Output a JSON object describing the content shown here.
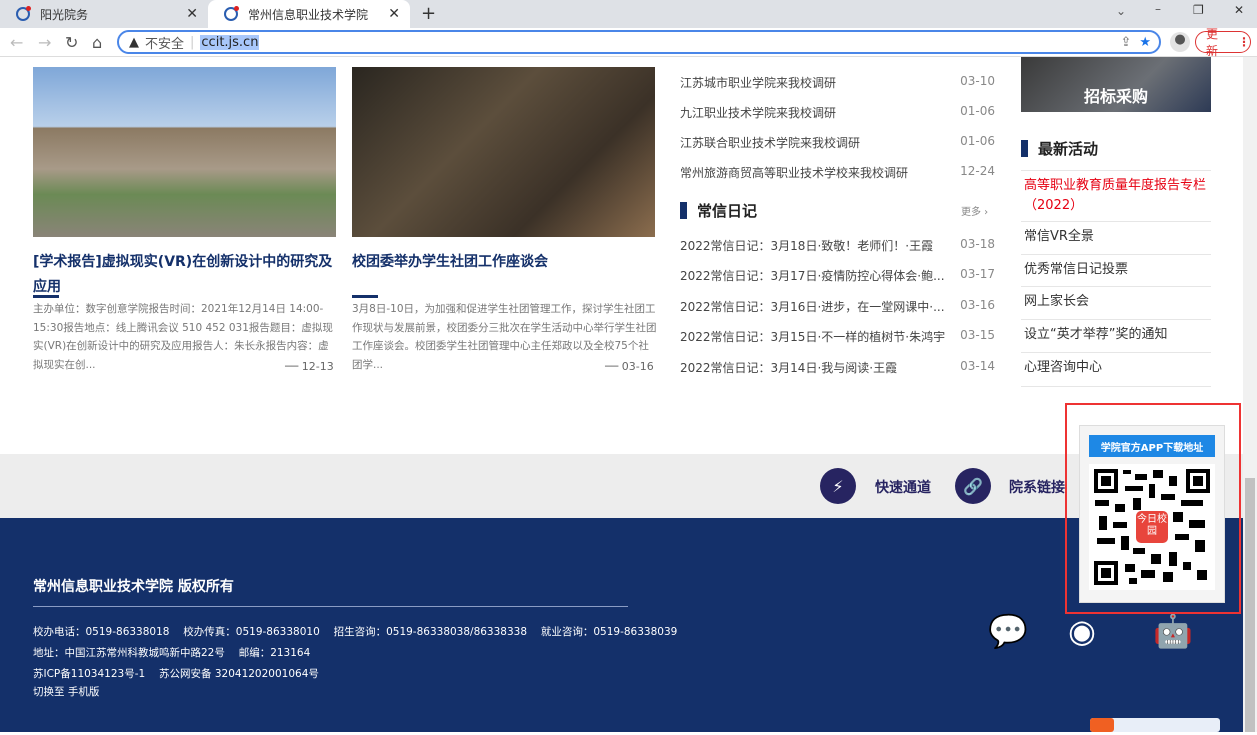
{
  "browser": {
    "tabs": [
      {
        "label": "阳光院务"
      },
      {
        "label": "常州信息职业技术学院"
      }
    ],
    "security": "不安全",
    "url": "ccit.js.cn",
    "update_label": "更新"
  },
  "news_cards": [
    {
      "title": "[学术报告]虚拟现实(VR)在创新设计中的研究及应用",
      "desc": "主办单位：数字创意学院报告时间：2021年12月14日 14:00-15:30报告地点：线上腾讯会议 510 452 031报告题目：虚拟现实(VR)在创新设计中的研究及应用报告人：朱长永报告内容：虚拟现实在创...",
      "date": "12-13"
    },
    {
      "title": "校团委举办学生社团工作座谈会",
      "desc": "3月8日-10日，为加强和促进学生社团管理工作，探讨学生社团工作现状与发展前景，校团委分三批次在学生活动中心举行学生社团工作座谈会。校团委学生社团管理中心主任郑政以及全校75个社团学...",
      "date": "03-16"
    }
  ],
  "visits": [
    {
      "title": "江苏城市职业学院来我校调研",
      "date": "03-10"
    },
    {
      "title": "九江职业技术学院来我校调研",
      "date": "01-06"
    },
    {
      "title": "江苏联合职业技术学院来我校调研",
      "date": "01-06"
    },
    {
      "title": "常州旅游商贸高等职业技术学校来我校调研",
      "date": "12-24"
    }
  ],
  "diary": {
    "heading": "常信日记",
    "more": "更多",
    "items": [
      {
        "title": "2022常信日记：3月18日·致敬！老师们！·王霞",
        "date": "03-18"
      },
      {
        "title": "2022常信日记：3月17日·疫情防控心得体会·鲍...",
        "date": "03-17"
      },
      {
        "title": "2022常信日记：3月16日·进步，在一堂网课中·...",
        "date": "03-16"
      },
      {
        "title": "2022常信日记：3月15日·不一样的植树节·朱鸿宇",
        "date": "03-15"
      },
      {
        "title": "2022常信日记：3月14日·我与阅读·王霞",
        "date": "03-14"
      }
    ]
  },
  "sidebar": {
    "banner": "招标采购",
    "heading": "最新活动",
    "items": [
      "高等职业教育质量年度报告专栏（2022）",
      "常信VR全景",
      "优秀常信日记投票",
      "网上家长会",
      "设立“英才举荐”奖的通知",
      "心理咨询中心"
    ],
    "highlight_color": "#e60012"
  },
  "links_band": {
    "quick": "快速通道",
    "dept": "院系链接"
  },
  "footer": {
    "title": "常州信息职业技术学院 版权所有",
    "line1": "校办电话：0519-86338018　 校办传真：0519-86338010　 招生咨询：0519-86338038/86338338　 就业咨询：0519-86338039",
    "line2": "地址：中国江苏常州科教城鸣新中路22号　 邮编：213164",
    "line3": "苏ICP备11034123号-1　 苏公网安备 32041202001064号",
    "line4": "切换至 手机版"
  },
  "app_popup": {
    "label": "学院官方APP下载地址",
    "qr_badge": "今日校园"
  },
  "colors": {
    "navy": "#14306a",
    "accent_blue": "#1e88e5"
  }
}
